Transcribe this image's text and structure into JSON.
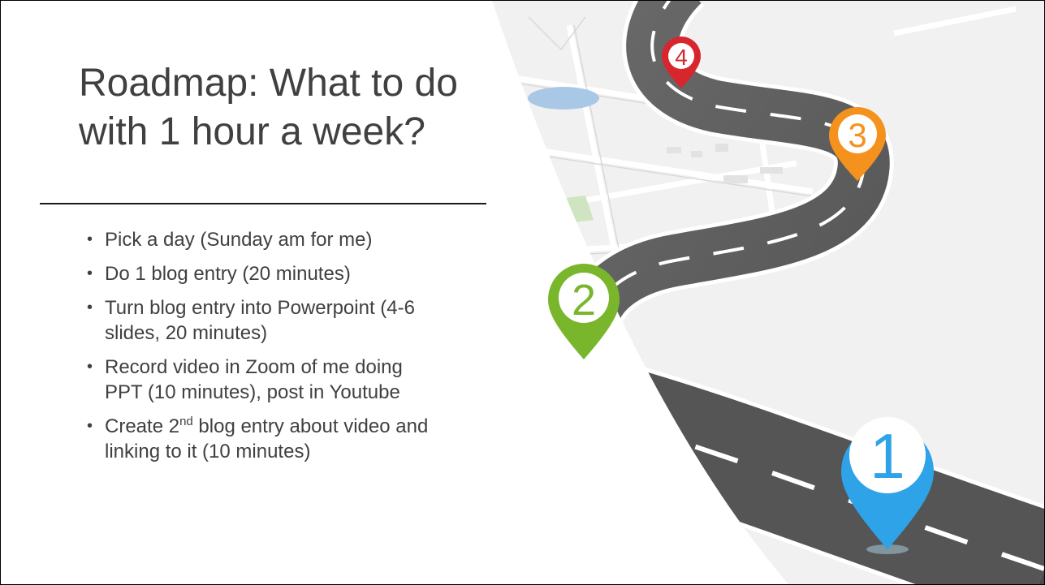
{
  "slide": {
    "title_line1": "Roadmap: What to do",
    "title_line2": "with 1 hour a week?",
    "bullets": [
      {
        "text": "Pick a day (Sunday am for me)"
      },
      {
        "text": "Do 1 blog entry (20 minutes)"
      },
      {
        "text_line1": "Turn blog entry into Powerpoint (4-6",
        "text_line2": "slides, 20 minutes)"
      },
      {
        "text_line1": "Record video in Zoom of me doing",
        "text_line2": "PPT (10 minutes), post in Youtube"
      },
      {
        "text_pre": "Create 2",
        "text_sup": "nd",
        "text_post": " blog entry about video and",
        "text_line2": "linking to it (10 minutes)"
      }
    ]
  },
  "roadmap_art": {
    "pins": [
      {
        "label": "4",
        "color": "#d7262e"
      },
      {
        "label": "3",
        "color": "#f5921e"
      },
      {
        "label": "2",
        "color": "#7ab62c"
      },
      {
        "label": "1",
        "color": "#2ea3e8"
      }
    ],
    "road_color": "#555555",
    "map_bg_color": "#f1f1f1"
  }
}
